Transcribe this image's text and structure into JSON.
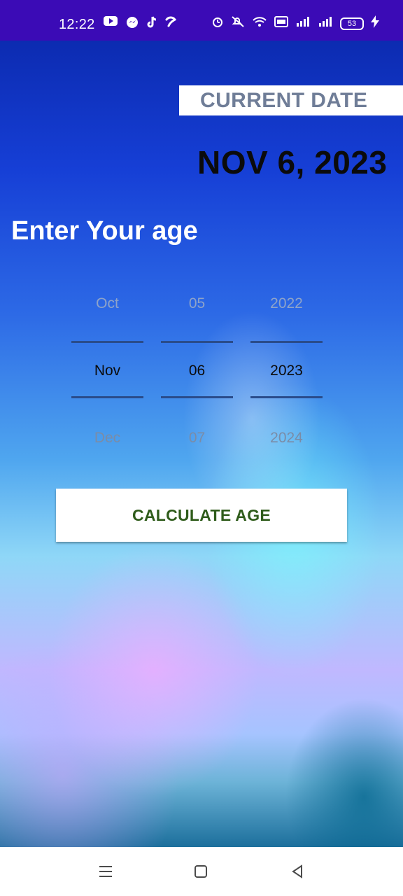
{
  "status_bar": {
    "time": "12:22",
    "left_icons": [
      "youtube-icon",
      "messenger-icon",
      "tiktok-icon",
      "hook-icon"
    ],
    "right_icons": [
      "alarm-icon",
      "mute-icon",
      "wifi-icon",
      "volte-icon",
      "signal-icon",
      "signal-icon"
    ],
    "battery_level": "53"
  },
  "header": {
    "label": "CURRENT DATE",
    "date": "NOV 6, 2023"
  },
  "form": {
    "title": "Enter Your age",
    "picker": {
      "month": {
        "prev": "Oct",
        "selected": "Nov",
        "next": "Dec"
      },
      "day": {
        "prev": "05",
        "selected": "06",
        "next": "07"
      },
      "year": {
        "prev": "2022",
        "selected": "2023",
        "next": "2024"
      }
    },
    "button_label": "CALCULATE AGE"
  },
  "nav_bar": {
    "items": [
      "menu-icon",
      "home-icon",
      "back-icon"
    ]
  }
}
